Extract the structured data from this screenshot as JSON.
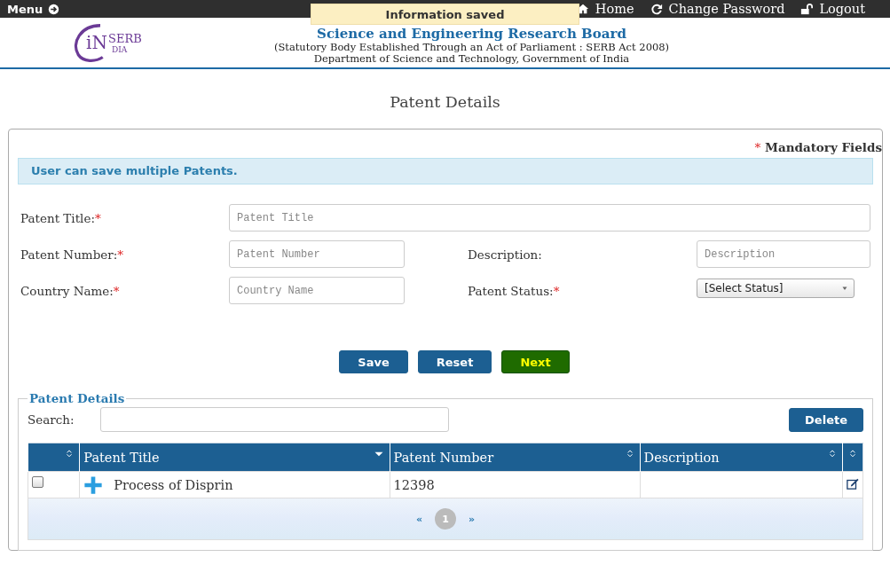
{
  "topbar": {
    "menu": "Menu",
    "links": [
      {
        "label": "Home",
        "kind": "home"
      },
      {
        "label": "Change Password",
        "kind": "refresh"
      },
      {
        "label": "Logout",
        "kind": "unlock"
      }
    ]
  },
  "toast": "Information saved",
  "header": {
    "logo": {
      "mark": "iN",
      "name": "SERB",
      "sub": "DIA"
    },
    "title": "Science and Engineering Research Board",
    "subtitle": "(Statutory Body Established Through an Act of Parliament : SERB Act 2008)",
    "department": "Department of Science and Technology, Government of India"
  },
  "page_title": "Patent Details",
  "form": {
    "mandatory_mark": "*",
    "mandatory_note": "Mandatory Fields",
    "info": "User can save multiple Patents.",
    "rows": [
      [
        {
          "label": "Patent Title:",
          "mark": "*",
          "kind": "text",
          "placeholder": "Patent Title"
        }
      ],
      [
        {
          "label": "Patent Number:",
          "mark": "*",
          "kind": "text",
          "placeholder": "Patent Number"
        },
        {
          "label": "Description:",
          "kind": "text",
          "placeholder": "Description"
        }
      ],
      [
        {
          "label": "Country Name:",
          "mark": "*",
          "kind": "text",
          "placeholder": "Country Name"
        },
        {
          "label": "Patent Status:",
          "mark": "*",
          "kind": "select",
          "value": "[Select Status]"
        }
      ]
    ],
    "buttons": [
      {
        "label": "Save",
        "kind": "primary"
      },
      {
        "label": "Reset",
        "kind": "primary"
      },
      {
        "label": "Next",
        "kind": "success"
      }
    ]
  },
  "grid": {
    "legend": "Patent Details",
    "search_label": "Search:",
    "delete": "Delete",
    "columns": [
      {
        "kind": "sort-both"
      },
      {
        "label": "Patent Title",
        "kind": "sort-desc"
      },
      {
        "label": "Patent Number",
        "kind": "sort-both"
      },
      {
        "label": "Description",
        "kind": "sort-both"
      },
      {
        "kind": "sort-both"
      }
    ],
    "rows": [
      {
        "checked": false,
        "expandable": true,
        "cells": [
          "",
          "Process of Disprin",
          "12398"
        ]
      }
    ],
    "pagination": {
      "prev": "«",
      "pages": [
        {
          "label": "1",
          "selected": true
        }
      ],
      "next": "»"
    }
  }
}
